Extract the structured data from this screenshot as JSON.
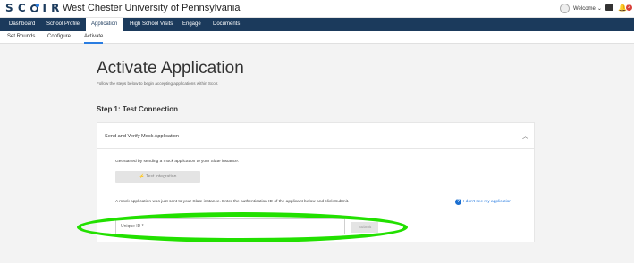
{
  "header": {
    "logo_text": "SCIR",
    "university": "West Chester University of Pennsylvania",
    "welcome": "Welcome",
    "notification_count": "2"
  },
  "nav": {
    "items": [
      {
        "label": "Dashboard"
      },
      {
        "label": "School Profile"
      },
      {
        "label": "Application"
      },
      {
        "label": "High School Visits"
      },
      {
        "label": "Engage"
      },
      {
        "label": "Documents"
      }
    ],
    "active": "Application"
  },
  "subnav": {
    "items": [
      {
        "label": "Set Rounds"
      },
      {
        "label": "Configure"
      },
      {
        "label": "Activate"
      }
    ],
    "active": "Activate"
  },
  "page": {
    "title": "Activate Application",
    "subtitle": "Follow the steps below to begin accepting applications within Scoir.",
    "step_title": "Step 1: Test Connection"
  },
  "card": {
    "title": "Send and Verify Mock Application",
    "intro": "Get started by sending a mock application to your Slate instance.",
    "test_button": "Test Integration",
    "info": "A mock application was just sent to your Slate instance. Enter the authentication ID of the applicant below and click Submit.",
    "help_link": "I don't see my application",
    "input_placeholder": "Unique ID *",
    "submit_button": "Submit"
  },
  "colors": {
    "navy": "#1b3a5c",
    "accent_blue": "#2a7de1",
    "highlight_green": "#22e000"
  }
}
